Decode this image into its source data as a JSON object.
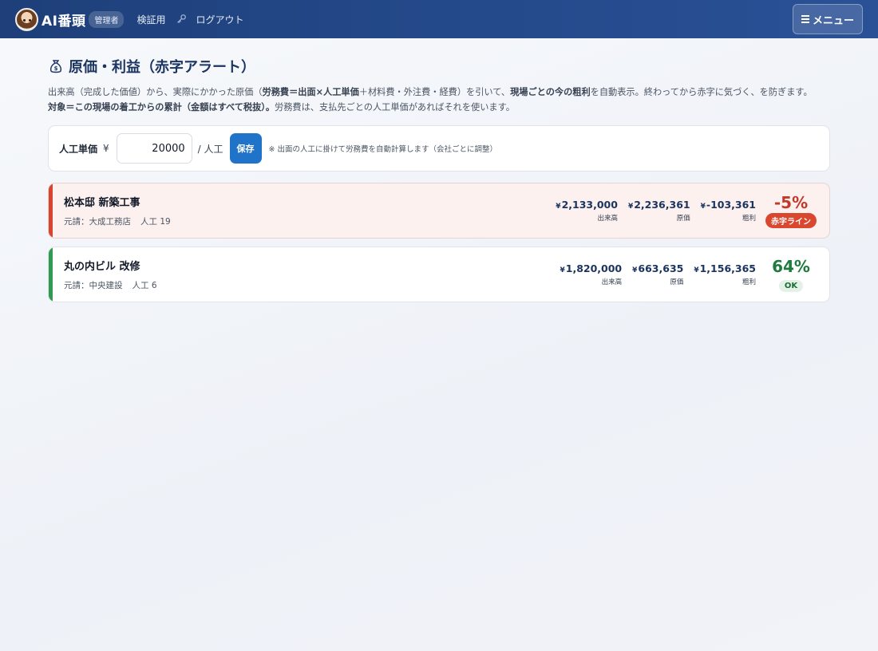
{
  "header": {
    "brand": "AI番頭",
    "role_badge": "管理者",
    "nav_verify": "検証用",
    "nav_logout": "ログアウト",
    "menu_label": "メニュー",
    "colors": {
      "bar": "#24498a"
    }
  },
  "page": {
    "title": "原価・利益（赤字アラート）",
    "desc_line1": {
      "p1": "出来高（完成した価値）から、実際にかかった原価（",
      "b1": "労務費＝出面×人工単価",
      "p2": "＋材料費・外注費・経費）を引いて、",
      "b2": "現場ごとの今の粗利",
      "p3": "を自動表示。終わってから赤字に気づく、を防ぎます。"
    },
    "desc_line2": {
      "b1": "対象＝この現場の着工からの累計（金額はすべて税抜）。",
      "p1": "労務費は、支払先ごとの人工単価があればそれを使います。"
    }
  },
  "rate": {
    "label": "人工単価",
    "currency": "¥",
    "value": "20000",
    "unit": "/ 人工",
    "save_label": "保存",
    "note": "※ 出面の人工に掛けて労務費を自動計算します（会社ごとに調整）"
  },
  "sites": [
    {
      "name": "松本邸 新築工事",
      "contractor": "元請：大成工務店",
      "labor": "人工 19",
      "revenue": "2,133,000",
      "cost": "2,236,361",
      "profit": "-103,361",
      "revenue_label": "出来高",
      "cost_label": "原価",
      "profit_label": "粗利",
      "margin": "-5%",
      "status": "赤字ライン",
      "accent": "#d6452f",
      "margin_color": "#c0392b",
      "badge_bg": "#d9472f",
      "badge_fg": "#ffffff"
    },
    {
      "name": "丸の内ビル 改修",
      "contractor": "元請：中央建設",
      "labor": "人工 6",
      "revenue": "1,820,000",
      "cost": "663,635",
      "profit": "1,156,365",
      "revenue_label": "出来高",
      "cost_label": "原価",
      "profit_label": "粗利",
      "margin": "64%",
      "status": "OK",
      "accent": "#2e9a52",
      "margin_color": "#1e7a3e",
      "badge_bg": "#e3f2e6",
      "badge_fg": "#1e6b37"
    }
  ],
  "icons": {
    "avatar": "avatar",
    "key": "key-icon",
    "menu": "hamburger-icon",
    "title": "money-bag-icon"
  }
}
